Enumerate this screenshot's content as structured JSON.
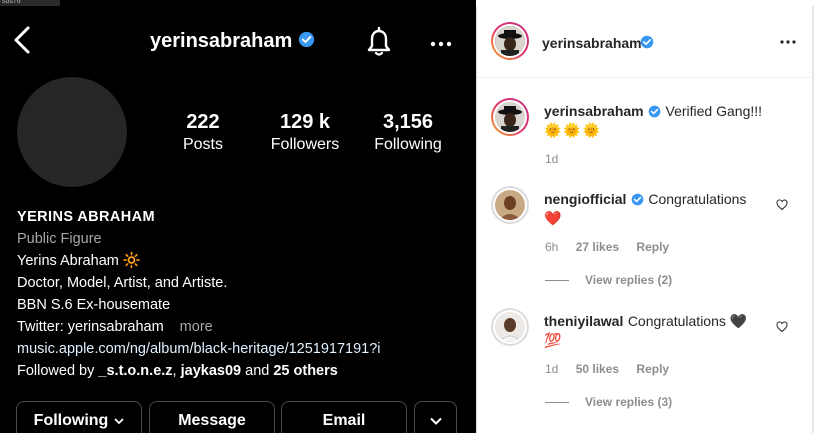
{
  "status_strip_text": "sos76",
  "profile": {
    "username": "yerinsabraham",
    "stats": [
      {
        "value": "222",
        "label": "Posts"
      },
      {
        "value": "129 k",
        "label": "Followers"
      },
      {
        "value": "3,156",
        "label": "Following"
      }
    ],
    "display_name": "YERINS ABRAHAM",
    "category": "Public Figure",
    "bio_lines": [
      "Yerins Abraham 🔆",
      "Doctor, Model, Artist, and Artiste.",
      "BBN S.6 Ex-housemate",
      "Twitter: yerinsabraham"
    ],
    "more_label": "more",
    "link": "music.apple.com/ng/album/black-heritage/1251917191?i",
    "followed_by_prefix": "Followed by",
    "followed_by_user1": "_s.t.o.n.e.z",
    "followed_by_sep": ",",
    "followed_by_user2": "jaykas09",
    "followed_by_and": "and",
    "followed_by_others": "25 others",
    "buttons": {
      "following": "Following",
      "message": "Message",
      "email": "Email"
    }
  },
  "post": {
    "author": "yerinsabraham",
    "caption_user": "yerinsabraham",
    "caption_text": "Verified Gang!!!",
    "caption_emoji": "🌞🌞🌞",
    "caption_time": "1d",
    "comments": [
      {
        "user": "nengiofficial",
        "text": "Congratulations",
        "emoji": "❤️",
        "time": "6h",
        "likes": "27 likes",
        "reply": "Reply",
        "view_replies": "View replies (2)"
      },
      {
        "user": "theniyilawal",
        "text": "Congratulations 🖤",
        "emoji": "💯",
        "time": "1d",
        "likes": "50 likes",
        "reply": "Reply",
        "view_replies": "View replies (3)"
      }
    ]
  },
  "colors": {
    "verified_blue": "#3897f0",
    "ring_gradient_start": "#f9a825",
    "ring_gradient_end": "#c13584"
  }
}
